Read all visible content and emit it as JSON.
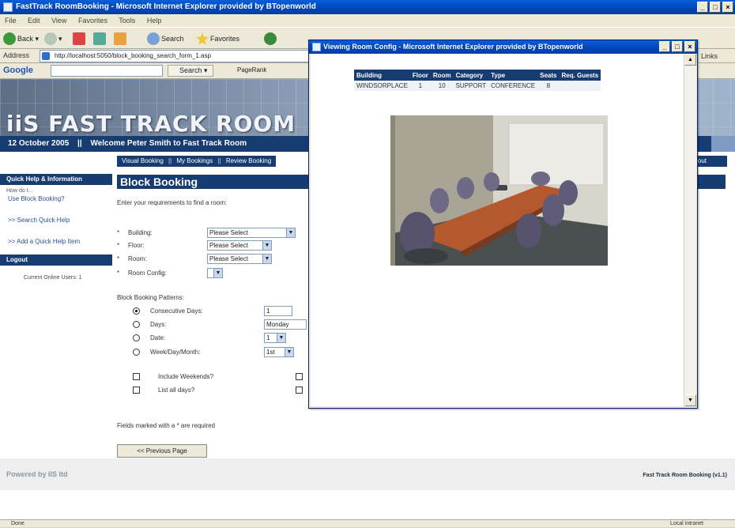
{
  "browser": {
    "title": "FastTrack RoomBooking - Microsoft Internet Explorer provided by BTopenworld",
    "menu": [
      "File",
      "Edit",
      "View",
      "Favorites",
      "Tools",
      "Help"
    ],
    "toolbar": {
      "back": "Back",
      "search": "Search",
      "favorites": "Favorites"
    },
    "address_label": "Address",
    "address_url": "http://localhost:5050/block_booking_search_form_1.asp",
    "links_label": "Links",
    "google": {
      "logo": "Google",
      "search_btn": "Search",
      "pagerank": "PageRank"
    }
  },
  "banner": {
    "brand": "iiS FAST TRACK ROOM",
    "date": "12 October 2005",
    "separator": "||",
    "welcome": "Welcome Peter Smith to Fast Track Room"
  },
  "topnav": {
    "visual": "Visual Booking",
    "mine": "My Bookings",
    "review": "Review Booking",
    "sep1": "||",
    "sep2": "||",
    "logout": "ogout"
  },
  "sidebar": {
    "quick_help_heading": "Quick Help & Information",
    "how_do_i": "How do I...",
    "use_block": "Use Block Booking?",
    "search_help": ">> Search Quick Help",
    "add_help": ">> Add a Quick Help Item",
    "logout_heading": "Logout",
    "online_users": "Current Online Users: 1"
  },
  "main": {
    "heading": "Block Booking",
    "intro": "Enter your requirements to find a room:",
    "building_label": "Building:",
    "building_value": "Please Select",
    "floor_label": "Floor:",
    "floor_value": "Please Select",
    "room_label": "Room:",
    "room_value": "Please Select",
    "config_label": "Room Config:",
    "patterns_label": "Block Booking Patterns:",
    "consecutive_label": "Consecutive Days:",
    "consecutive_value": "1",
    "days_label": "Days:",
    "days_value": "Monday",
    "date_label": "Date:",
    "date_value": "1",
    "wdm_label": "Week/Day/Month:",
    "wdm_value": "1st",
    "weekends_label": "Include Weekends?",
    "alldays_label": "List all days?",
    "required_note": "Fields marked with a * are required",
    "prev_button": "<< Previous Page",
    "star": "*"
  },
  "footer": {
    "powered": "Powered by IIS ltd",
    "version": "Fast Track Room Booking (v1.1)"
  },
  "status": {
    "done": "Done",
    "zone": "Local intranet"
  },
  "popup": {
    "title": "Viewing Room Config - Microsoft Internet Explorer provided by BTopenworld",
    "table": {
      "headers": [
        "Building",
        "Floor",
        "Room",
        "Category",
        "Type",
        "Seats",
        "Req. Guests"
      ],
      "row": [
        "WINDSORPLACE",
        "1",
        "10",
        "SUPPORT",
        "CONFERENCE",
        "8",
        ""
      ]
    }
  }
}
